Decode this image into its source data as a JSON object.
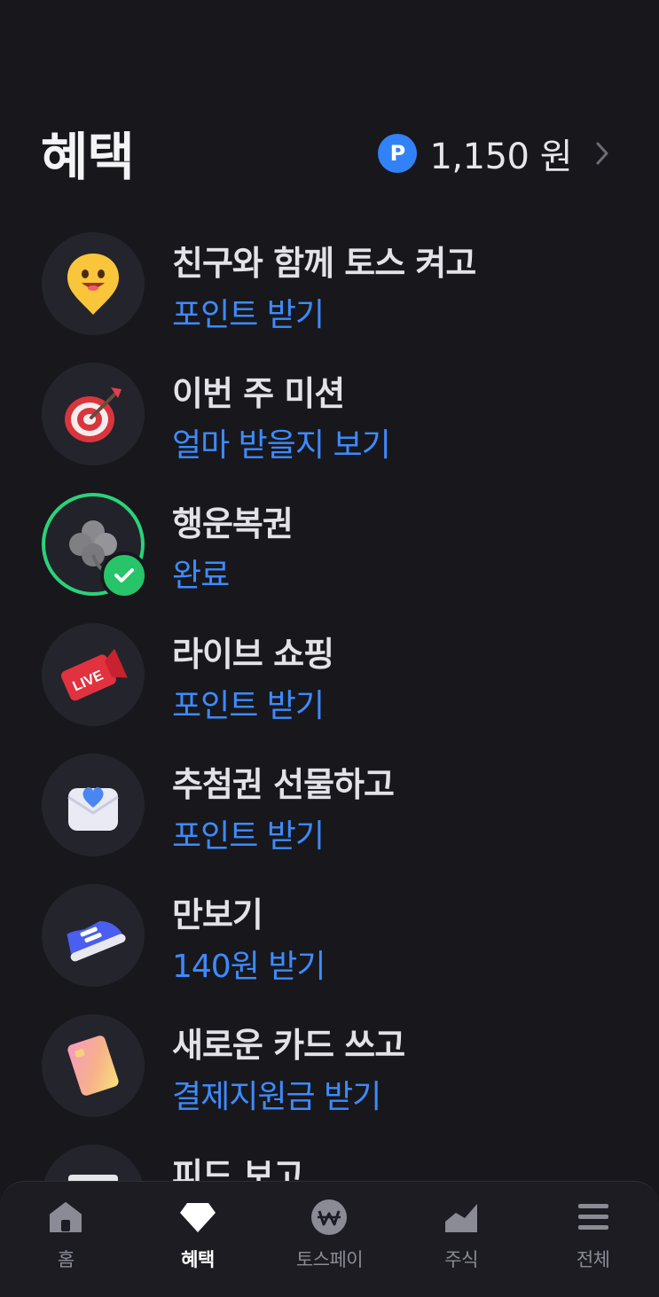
{
  "header": {
    "title": "혜택",
    "points_badge": "P",
    "points_amount": "1,150 원"
  },
  "items": [
    {
      "title": "친구와 함께 토스 켜고",
      "subtitle": "포인트 받기",
      "icon": "smiley-pin-icon",
      "status": "pending"
    },
    {
      "title": "이번 주 미션",
      "subtitle": "얼마 받을지 보기",
      "icon": "target-dart-icon",
      "status": "pending"
    },
    {
      "title": "행운복권",
      "subtitle": "완료",
      "icon": "clover-icon",
      "status": "completed"
    },
    {
      "title": "라이브 쇼핑",
      "subtitle": "포인트 받기",
      "icon": "live-tag-icon",
      "status": "pending"
    },
    {
      "title": "추첨권 선물하고",
      "subtitle": "포인트 받기",
      "icon": "heart-envelope-icon",
      "status": "pending"
    },
    {
      "title": "만보기",
      "subtitle": "140원 받기",
      "icon": "sneaker-icon",
      "status": "pending"
    },
    {
      "title": "새로운 카드 쓰고",
      "subtitle": "결제지원금 받기",
      "icon": "card-icon",
      "status": "pending"
    },
    {
      "title": "피드 보고",
      "subtitle": "",
      "icon": "feed-icon",
      "status": "pending"
    }
  ],
  "tabbar": {
    "tabs": [
      {
        "label": "홈",
        "icon": "home-icon",
        "active": false
      },
      {
        "label": "혜택",
        "icon": "diamond-icon",
        "active": true
      },
      {
        "label": "토스페이",
        "icon": "won-coin-icon",
        "active": false
      },
      {
        "label": "주식",
        "icon": "stock-chart-icon",
        "active": false
      },
      {
        "label": "전체",
        "icon": "menu-icon",
        "active": false
      }
    ]
  },
  "colors": {
    "background": "#17171c",
    "accent_blue": "#3d8bfd",
    "points_badge": "#3182f6",
    "success_green": "#27c46a"
  }
}
